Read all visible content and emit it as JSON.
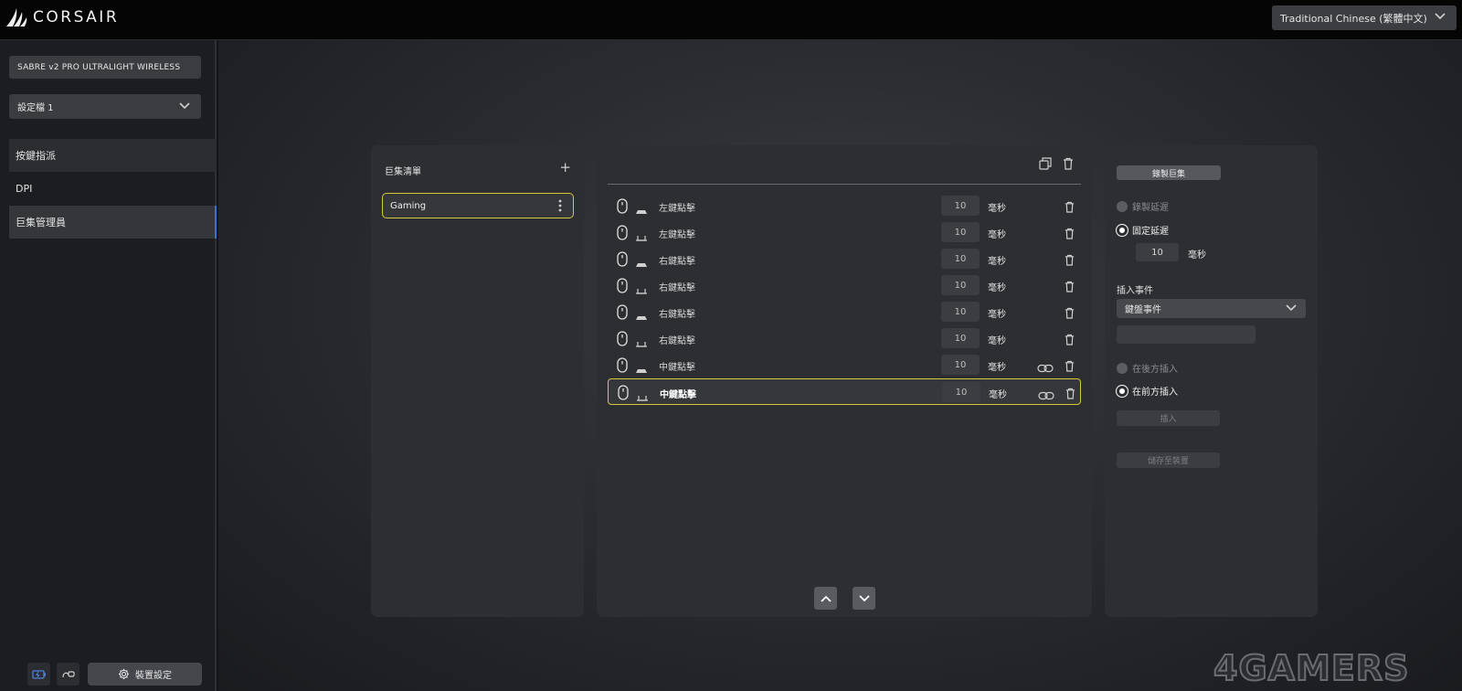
{
  "app": {
    "brand": "CORSAIR",
    "language": "Traditional Chinese (繁體中文)"
  },
  "sidebar": {
    "device_name": "SABRE v2 PRO ULTRALIGHT WIRELESS",
    "profile": "設定檔 1",
    "items": [
      {
        "label": "按鍵指派",
        "state": "highlighted"
      },
      {
        "label": "DPI",
        "state": "normal"
      },
      {
        "label": "巨集管理員",
        "state": "selected"
      }
    ],
    "device_settings_label": "裝置設定"
  },
  "macro_list": {
    "title": "巨集清單",
    "items": [
      {
        "name": "Gaming",
        "selected": true
      }
    ]
  },
  "events": {
    "rows": [
      {
        "direction": "down",
        "label": "左鍵點擊",
        "delay": "10",
        "unit": "毫秒",
        "linked": false,
        "selected": false
      },
      {
        "direction": "up",
        "label": "左鍵點擊",
        "delay": "10",
        "unit": "毫秒",
        "linked": false,
        "selected": false
      },
      {
        "direction": "down",
        "label": "右鍵點擊",
        "delay": "10",
        "unit": "毫秒",
        "linked": false,
        "selected": false
      },
      {
        "direction": "up",
        "label": "右鍵點擊",
        "delay": "10",
        "unit": "毫秒",
        "linked": false,
        "selected": false
      },
      {
        "direction": "down",
        "label": "右鍵點擊",
        "delay": "10",
        "unit": "毫秒",
        "linked": false,
        "selected": false
      },
      {
        "direction": "up",
        "label": "右鍵點擊",
        "delay": "10",
        "unit": "毫秒",
        "linked": false,
        "selected": false
      },
      {
        "direction": "down",
        "label": "中鍵點擊",
        "delay": "10",
        "unit": "毫秒",
        "linked": true,
        "selected": false
      },
      {
        "direction": "up",
        "label": "中鍵點擊",
        "delay": "10",
        "unit": "毫秒",
        "linked": true,
        "selected": true
      }
    ]
  },
  "recorder": {
    "record_button": "錄製巨集",
    "record_delay": "錄製延遲",
    "fixed_delay": "固定延遲",
    "delay_value": "10",
    "delay_unit": "毫秒",
    "insert_event_title": "插入事件",
    "event_type": "鍵盤事件",
    "insert_after": "在後方插入",
    "insert_before": "在前方插入",
    "insert_button": "插入",
    "save_button": "儲存至裝置"
  },
  "watermark": "4GAMERS",
  "colors": {
    "selection": "#d7c93a",
    "nav_accent": "#3a6fd8"
  }
}
